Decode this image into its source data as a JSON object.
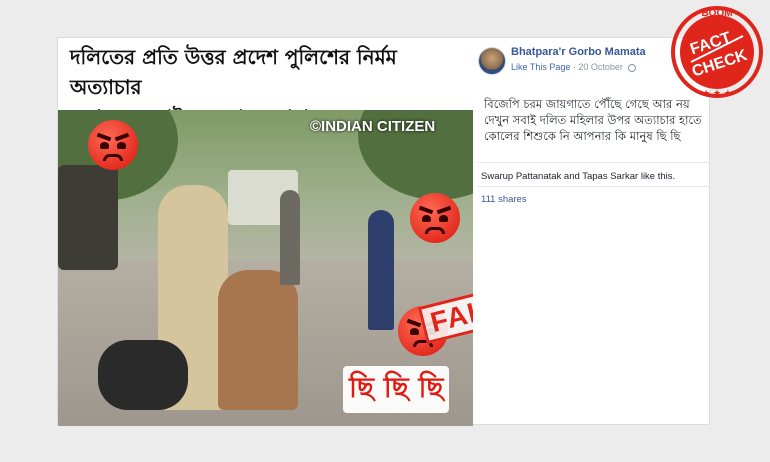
{
  "post": {
    "headline_line1": "দলিতের প্রতি উত্তর প্রদেশ পুলিশের নির্মম অত্যাচার",
    "headline_line2": "দেখুন ও সবাইকে দেখতে সাহায্য করুন",
    "watermark": "©INDIAN CITIZEN",
    "fake_stamp": "FAKE",
    "shame_text": "ছি ছি ছি",
    "page_name": "Bhatpara'r Gorbo Mamata",
    "like_link": "Like This Page",
    "date": "20 October",
    "body_text": "বিজেপি চরম জায়গাতে পৌঁছে গেছে আর নয় দেখুন সবাই দলিত মহিলার উপর অত্যাচার হাতে কোলের শিশুকে নি আপনার কি মানুষ ছি ছি",
    "likes_text": "Swarup Pattanatak and Tapas Sarkar like this.",
    "shares_text": "111 shares"
  },
  "badge": {
    "top": "BOOM",
    "line1": "FACT",
    "line2": "CHECK",
    "color": "#e0251b"
  },
  "icons": [
    "angry-face-icon",
    "globe-icon"
  ]
}
